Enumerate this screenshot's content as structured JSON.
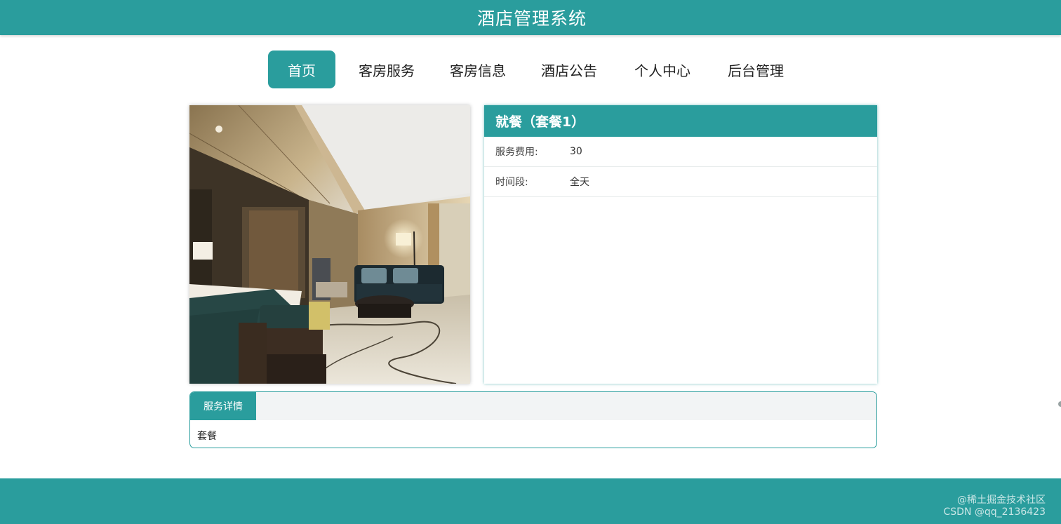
{
  "header": {
    "title": "酒店管理系统"
  },
  "nav": {
    "items": [
      {
        "label": "首页",
        "active": true
      },
      {
        "label": "客房服务",
        "active": false
      },
      {
        "label": "客房信息",
        "active": false
      },
      {
        "label": "酒店公告",
        "active": false
      },
      {
        "label": "个人中心",
        "active": false
      },
      {
        "label": "后台管理",
        "active": false
      }
    ]
  },
  "service": {
    "title": "就餐（套餐1）",
    "fields": [
      {
        "label": "服务费用:",
        "value": "30"
      },
      {
        "label": "时间段:",
        "value": "全天"
      }
    ]
  },
  "details": {
    "tab_label": "服务详情",
    "content": "套餐"
  },
  "watermark": {
    "line1": "@稀土掘金技术社区",
    "line2": "CSDN @qq_2136423"
  },
  "colors": {
    "accent": "#2a9d9d",
    "tab_bar_bg": "#f2f4f5"
  }
}
